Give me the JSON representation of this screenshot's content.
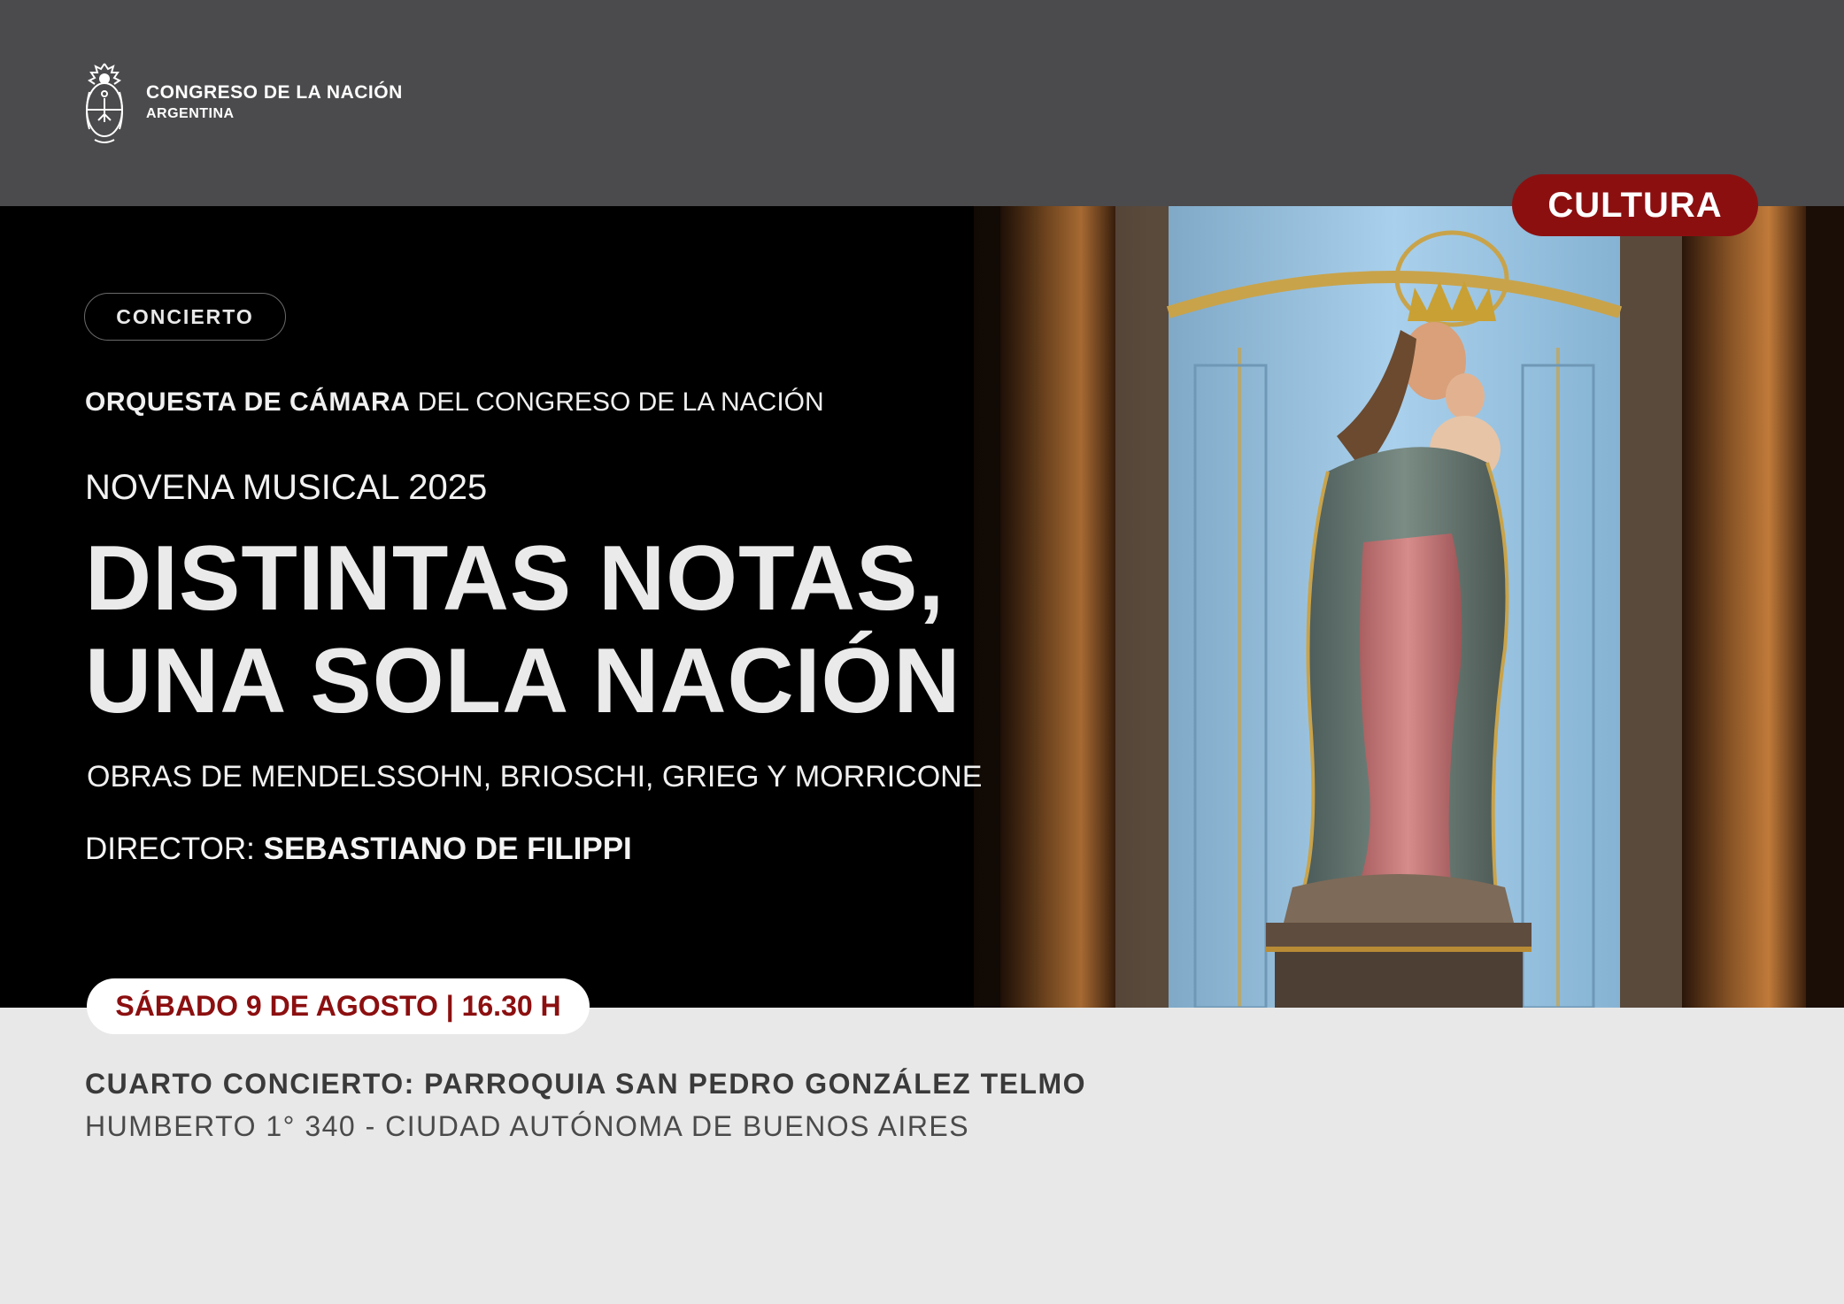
{
  "header": {
    "institution": "CONGRESO DE LA NACIÓN",
    "country": "ARGENTINA",
    "seal_icon": "coat-of-arms-icon"
  },
  "category": "CULTURA",
  "event": {
    "type_tag": "CONCIERTO",
    "orchestra_bold": "ORQUESTA DE CÁMARA",
    "orchestra_rest": "DEL CONGRESO DE LA NACIÓN",
    "series": "NOVENA MUSICAL 2025",
    "title_line1": "DISTINTAS NOTAS,",
    "title_line2": "UNA SOLA NACIÓN",
    "works": "OBRAS DE MENDELSSOHN, BRIOSCHI, GRIEG Y MORRICONE",
    "director_label": "DIRECTOR:",
    "director_name": "SEBASTIANO DE FILIPPI",
    "date_time": "SÁBADO 9 DE AGOSTO | 16.30 H",
    "venue": "CUARTO CONCIERTO: PARROQUIA SAN PEDRO GONZÁLEZ TELMO",
    "address": "HUMBERTO 1° 340 - CIUDAD AUTÓNOMA DE BUENOS AIRES"
  },
  "colors": {
    "accent_red": "#8c0f10",
    "header_gray": "#4b4a4c",
    "footer_gray": "#e8e8e8"
  }
}
